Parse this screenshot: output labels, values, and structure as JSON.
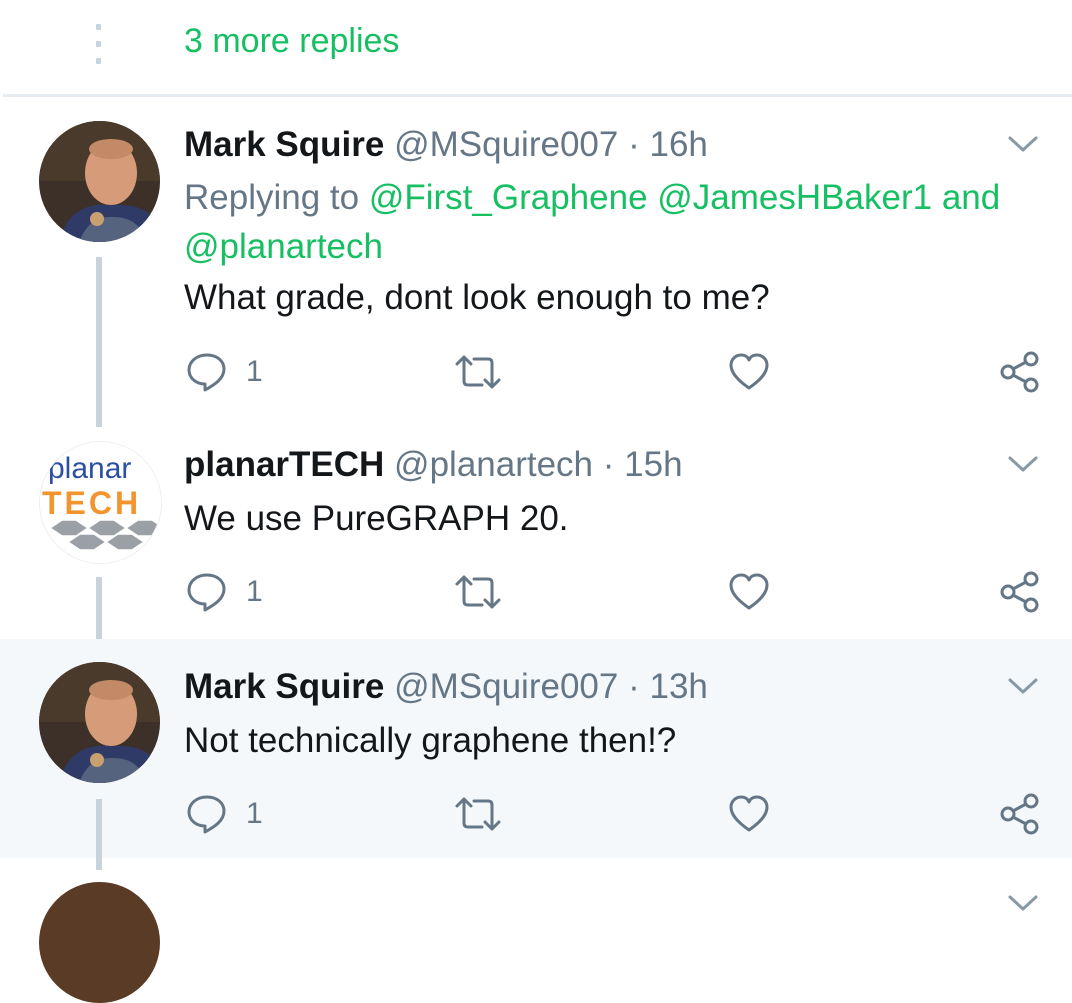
{
  "thread": {
    "more_replies_label": "3 more replies"
  },
  "tweets": [
    {
      "name": "Mark Squire",
      "handle": "@MSquire007",
      "separator": "·",
      "time": "16h",
      "replying_prefix": "Replying to",
      "mentions": [
        "@First_Graphene",
        "@JamesHBaker1"
      ],
      "mentions_joiner": "and",
      "mentions_last": "@planartech",
      "text": "What grade, dont look enough to me?",
      "reply_count": "1"
    },
    {
      "name": "planarTECH",
      "handle": "@planartech",
      "separator": "·",
      "time": "15h",
      "avatar_logo": {
        "line1": "planar",
        "line2": "TECH"
      },
      "text": "We use PureGRAPH 20.",
      "reply_count": "1"
    },
    {
      "name": "Mark Squire",
      "handle": "@MSquire007",
      "separator": "·",
      "time": "13h",
      "text": "Not technically graphene then!?",
      "reply_count": "1"
    }
  ],
  "colors": {
    "accent": "#17bf63",
    "secondary_text": "#657786",
    "primary_text": "#14171a",
    "highlight_bg": "#f5f8fa",
    "thread_line": "#c9d3dc"
  },
  "icons": [
    "reply-icon",
    "retweet-icon",
    "like-icon",
    "share-icon",
    "chevron-down-icon"
  ]
}
